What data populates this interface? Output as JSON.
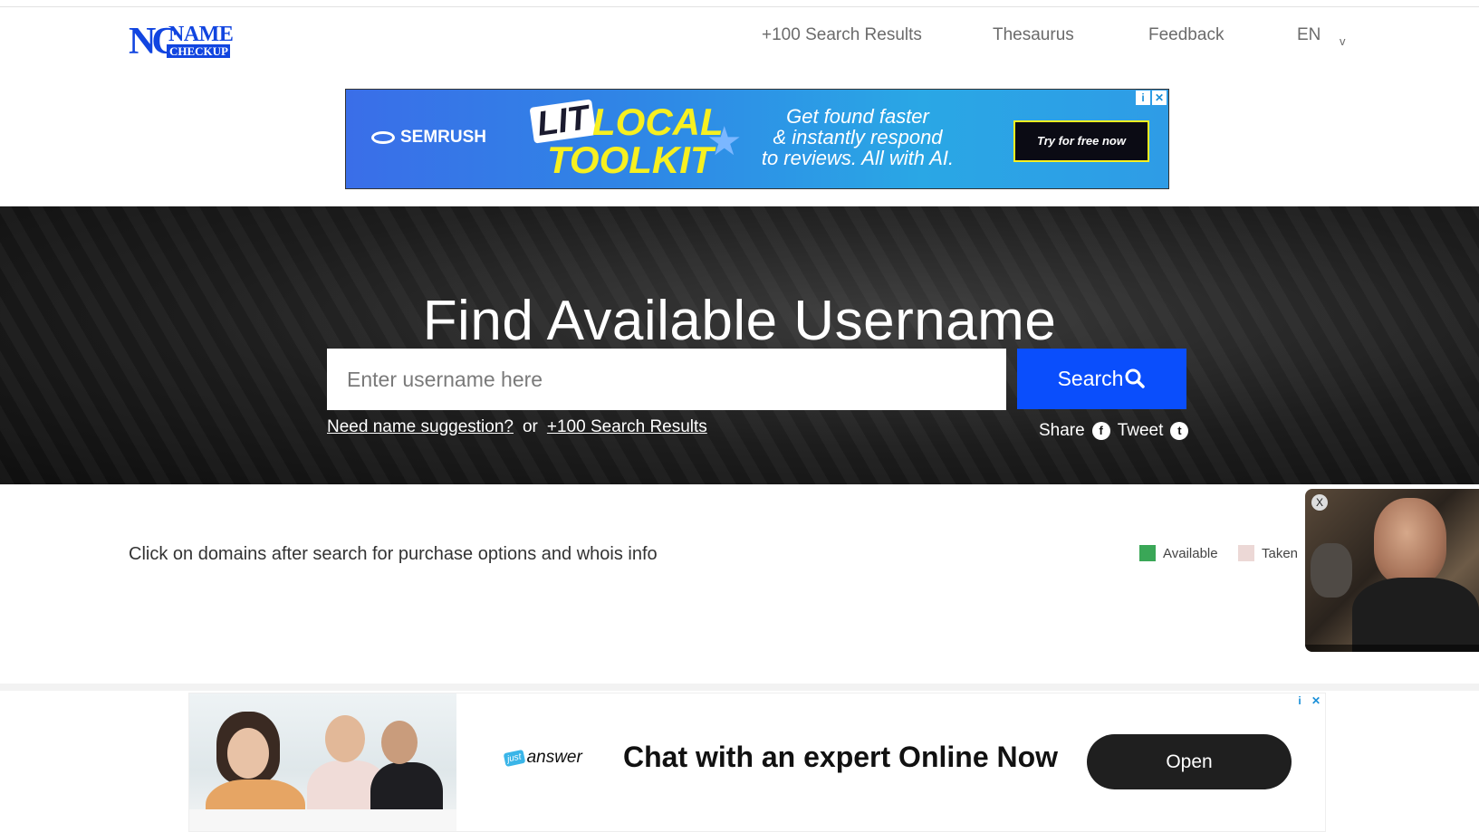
{
  "header": {
    "logo": {
      "mark": "NC",
      "name": "NAME",
      "sub": "CHECKUP"
    },
    "nav": [
      {
        "label": "+100 Search Results"
      },
      {
        "label": "Thesaurus"
      },
      {
        "label": "Feedback"
      },
      {
        "label": "EN"
      }
    ],
    "lang_chevron": "v"
  },
  "ad_top": {
    "brand": "SEMRUSH",
    "lit": "LIT",
    "local": "LOCAL",
    "toolkit": "TOOLKIT",
    "tagline": [
      "Get found faster",
      "& instantly respond",
      "to reviews. All with AI."
    ],
    "cta": "Try for free now"
  },
  "hero": {
    "title": "Find Available Username",
    "search_placeholder": "Enter username here",
    "search_button": "Search",
    "suggestion_link": "Need name suggestion?",
    "or_text": "or",
    "results_link": "+100 Search Results",
    "share_label": "Share",
    "tweet_label": "Tweet"
  },
  "info": {
    "hint": "Click on domains after search for purchase options and whois info",
    "legend": [
      {
        "label": "Available",
        "color": "#3aa757"
      },
      {
        "label": "Taken",
        "color": "#ecd8d6"
      }
    ]
  },
  "video": {
    "close_label": "X"
  },
  "ad_bottom": {
    "brand_badge": "just",
    "brand_word": "answer",
    "headline": "Chat with an expert Online Now",
    "cta": "Open"
  },
  "colors": {
    "accent": "#0a4efc",
    "logo": "#1145e0",
    "hero_bg": "#1c1c1c"
  }
}
